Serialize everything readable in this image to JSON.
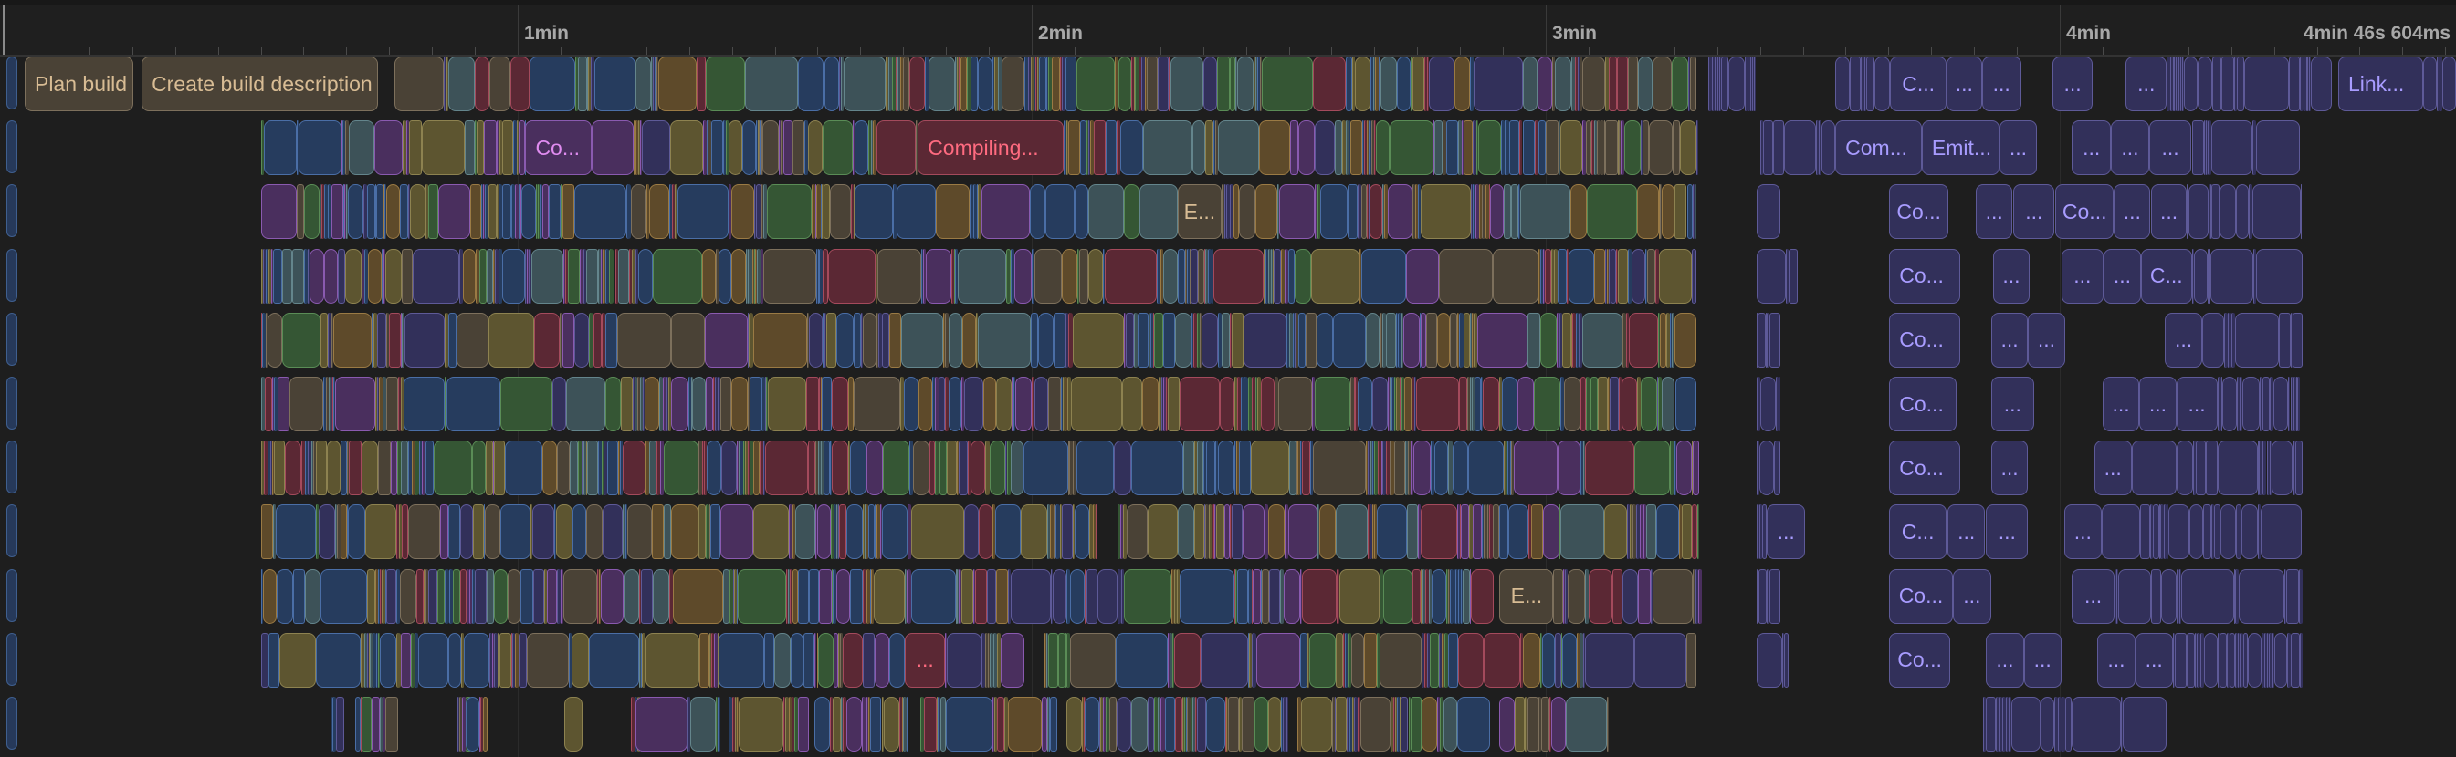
{
  "timeline": {
    "px_per_second_note": "scale handled in script",
    "axis": {
      "major_ticks": [
        {
          "seconds": 60,
          "label": "1min"
        },
        {
          "seconds": 120,
          "label": "2min"
        },
        {
          "seconds": 180,
          "label": "3min"
        },
        {
          "seconds": 240,
          "label": "4min"
        }
      ],
      "minor_tick_interval_seconds": 5,
      "end_label": "4min 46s 604ms",
      "total_duration_seconds": 286.604
    },
    "palette": {
      "olive": {
        "fill": "#5d5530",
        "border": "#8d8250",
        "text": "#d8c88a"
      },
      "blue": {
        "fill": "#263c5e",
        "border": "#4a6ea6",
        "text": "#9cc0ff"
      },
      "red": {
        "fill": "#5b2834",
        "border": "#a44a5c",
        "text": "#ff6b80"
      },
      "purple": {
        "fill": "#4a2f5e",
        "border": "#8a5ab0",
        "text": "#e08cf0"
      },
      "teal": {
        "fill": "#3d5258",
        "border": "#64858c",
        "text": "#a8d4dc"
      },
      "brown": {
        "fill": "#4a4236",
        "border": "#7d705c",
        "text": "#d8bc94"
      },
      "indigo": {
        "fill": "#32305a",
        "border": "#5e5a98",
        "text": "#a89cff"
      },
      "green": {
        "fill": "#355634",
        "border": "#5a8c56",
        "text": "#9ad896"
      },
      "orange": {
        "fill": "#5e4a2a",
        "border": "#9a7a44",
        "text": "#e6b878"
      }
    },
    "mixes": {
      "early": [
        "olive",
        "blue",
        "red",
        "purple",
        "teal",
        "brown",
        "indigo",
        "green",
        "orange",
        "blue",
        "blue",
        "olive"
      ],
      "mid": [
        "blue",
        "blue",
        "purple",
        "teal",
        "olive",
        "green",
        "red",
        "brown",
        "indigo",
        "orange"
      ],
      "late": [
        "brown",
        "brown",
        "red",
        "olive",
        "teal",
        "green",
        "purple",
        "indigo",
        "brown"
      ],
      "link": [
        "indigo"
      ]
    },
    "lanes": [
      {
        "name": "lane-1",
        "labeled": [
          {
            "start": 2.45,
            "end": 15.1,
            "color": "brown",
            "label": "Plan build"
          },
          {
            "start": 16.1,
            "end": 43.7,
            "color": "brown",
            "label": "Create build description"
          },
          {
            "start": 220.2,
            "end": 226.8,
            "color": "indigo",
            "label": "C..."
          },
          {
            "start": 226.8,
            "end": 230.9,
            "color": "indigo",
            "label": "..."
          },
          {
            "start": 230.9,
            "end": 235.5,
            "color": "indigo",
            "label": "..."
          },
          {
            "start": 239.2,
            "end": 243.8,
            "color": "indigo",
            "label": "..."
          },
          {
            "start": 247.7,
            "end": 252.5,
            "color": "indigo",
            "label": "..."
          },
          {
            "start": 272.5,
            "end": 282.4,
            "color": "indigo",
            "label": "Link..."
          }
        ],
        "streams": [
          {
            "start": 45.6,
            "end": 119.2,
            "mix": "early",
            "seed": 11
          },
          {
            "start": 119.2,
            "end": 179.0,
            "mix": "mid",
            "seed": 12
          },
          {
            "start": 179.0,
            "end": 197.6,
            "mix": "late",
            "seed": 13
          },
          {
            "start": 199.0,
            "end": 204.5,
            "mix": "link",
            "seed": 14
          },
          {
            "start": 213.8,
            "end": 220.2,
            "mix": "link",
            "seed": 15
          },
          {
            "start": 252.5,
            "end": 271.8,
            "mix": "link",
            "seed": 16
          },
          {
            "start": 282.4,
            "end": 286.6,
            "mix": "link",
            "seed": 17
          }
        ]
      },
      {
        "name": "lane-2",
        "labeled": [
          {
            "start": 60.9,
            "end": 68.6,
            "color": "purple",
            "label": "Co..."
          },
          {
            "start": 106.7,
            "end": 123.7,
            "color": "red",
            "label": "Compiling..."
          },
          {
            "start": 213.8,
            "end": 223.9,
            "color": "indigo",
            "label": "Com..."
          },
          {
            "start": 223.9,
            "end": 233.0,
            "color": "indigo",
            "label": "Emit..."
          },
          {
            "start": 233.0,
            "end": 237.3,
            "color": "indigo",
            "label": "..."
          },
          {
            "start": 241.4,
            "end": 246.0,
            "color": "indigo",
            "label": "..."
          },
          {
            "start": 246.0,
            "end": 250.4,
            "color": "indigo",
            "label": "..."
          },
          {
            "start": 250.4,
            "end": 255.4,
            "color": "indigo",
            "label": "..."
          }
        ],
        "streams": [
          {
            "start": 30.0,
            "end": 60.9,
            "mix": "early",
            "seed": 21
          },
          {
            "start": 68.6,
            "end": 106.7,
            "mix": "early",
            "seed": 22
          },
          {
            "start": 123.7,
            "end": 180.0,
            "mix": "mid",
            "seed": 23
          },
          {
            "start": 180.0,
            "end": 197.8,
            "mix": "late",
            "seed": 24
          },
          {
            "start": 205.0,
            "end": 213.8,
            "mix": "link",
            "seed": 25
          },
          {
            "start": 255.4,
            "end": 268.0,
            "mix": "link",
            "seed": 26
          }
        ]
      },
      {
        "name": "lane-3",
        "labeled": [
          {
            "start": 137.0,
            "end": 142.2,
            "color": "brown",
            "label": "E..."
          },
          {
            "start": 220.1,
            "end": 227.0,
            "color": "indigo",
            "label": "Co..."
          },
          {
            "start": 230.2,
            "end": 234.5,
            "color": "indigo",
            "label": "..."
          },
          {
            "start": 234.6,
            "end": 239.4,
            "color": "indigo",
            "label": "..."
          },
          {
            "start": 239.5,
            "end": 246.3,
            "color": "indigo",
            "label": "Co..."
          },
          {
            "start": 246.3,
            "end": 250.6,
            "color": "indigo",
            "label": "..."
          },
          {
            "start": 250.7,
            "end": 254.8,
            "color": "indigo",
            "label": "..."
          }
        ],
        "streams": [
          {
            "start": 30.0,
            "end": 137.0,
            "mix": "early",
            "seed": 31
          },
          {
            "start": 142.2,
            "end": 197.6,
            "mix": "mid",
            "seed": 32
          },
          {
            "start": 204.6,
            "end": 207.4,
            "mix": "link",
            "seed": 33
          },
          {
            "start": 254.8,
            "end": 268.2,
            "mix": "link",
            "seed": 34
          }
        ]
      },
      {
        "name": "lane-4",
        "labeled": [
          {
            "start": 220.1,
            "end": 228.4,
            "color": "indigo",
            "label": "Co..."
          },
          {
            "start": 232.2,
            "end": 236.5,
            "color": "indigo",
            "label": "..."
          },
          {
            "start": 240.2,
            "end": 245.1,
            "color": "indigo",
            "label": "..."
          },
          {
            "start": 245.1,
            "end": 249.5,
            "color": "indigo",
            "label": "..."
          },
          {
            "start": 249.5,
            "end": 255.4,
            "color": "indigo",
            "label": "C..."
          }
        ],
        "streams": [
          {
            "start": 30.0,
            "end": 197.6,
            "mix": "mid",
            "seed": 41
          },
          {
            "start": 204.6,
            "end": 209.4,
            "mix": "link",
            "seed": 42
          },
          {
            "start": 255.4,
            "end": 268.3,
            "mix": "link",
            "seed": 43
          }
        ]
      },
      {
        "name": "lane-5",
        "labeled": [
          {
            "start": 220.1,
            "end": 228.4,
            "color": "indigo",
            "label": "Co..."
          },
          {
            "start": 232.0,
            "end": 236.3,
            "color": "indigo",
            "label": "..."
          },
          {
            "start": 236.3,
            "end": 240.6,
            "color": "indigo",
            "label": "..."
          },
          {
            "start": 252.3,
            "end": 256.6,
            "color": "indigo",
            "label": "..."
          }
        ],
        "streams": [
          {
            "start": 30.0,
            "end": 197.6,
            "mix": "mid",
            "seed": 51
          },
          {
            "start": 204.6,
            "end": 207.4,
            "mix": "link",
            "seed": 52
          },
          {
            "start": 256.6,
            "end": 268.3,
            "mix": "link",
            "seed": 53
          }
        ]
      },
      {
        "name": "lane-6",
        "labeled": [
          {
            "start": 220.1,
            "end": 228.0,
            "color": "indigo",
            "label": "Co..."
          },
          {
            "start": 232.0,
            "end": 237.0,
            "color": "indigo",
            "label": "..."
          },
          {
            "start": 245.0,
            "end": 249.3,
            "color": "indigo",
            "label": "..."
          },
          {
            "start": 249.3,
            "end": 253.6,
            "color": "indigo",
            "label": "..."
          },
          {
            "start": 253.6,
            "end": 258.4,
            "color": "indigo",
            "label": "..."
          }
        ],
        "streams": [
          {
            "start": 30.0,
            "end": 197.6,
            "mix": "mid",
            "seed": 61
          },
          {
            "start": 204.6,
            "end": 207.4,
            "mix": "link",
            "seed": 62
          },
          {
            "start": 258.4,
            "end": 268.0,
            "mix": "link",
            "seed": 63
          }
        ]
      },
      {
        "name": "lane-7",
        "labeled": [
          {
            "start": 220.1,
            "end": 228.4,
            "color": "indigo",
            "label": "Co..."
          },
          {
            "start": 232.0,
            "end": 236.3,
            "color": "indigo",
            "label": "..."
          },
          {
            "start": 244.0,
            "end": 248.4,
            "color": "indigo",
            "label": "..."
          }
        ],
        "streams": [
          {
            "start": 30.0,
            "end": 197.9,
            "mix": "mid",
            "seed": 71
          },
          {
            "start": 204.6,
            "end": 207.4,
            "mix": "link",
            "seed": 72
          },
          {
            "start": 248.4,
            "end": 268.3,
            "mix": "link",
            "seed": 73
          }
        ]
      },
      {
        "name": "lane-8",
        "labeled": [
          {
            "start": 205.8,
            "end": 210.3,
            "color": "indigo",
            "label": "..."
          },
          {
            "start": 220.1,
            "end": 226.8,
            "color": "indigo",
            "label": "C..."
          },
          {
            "start": 226.9,
            "end": 231.3,
            "color": "indigo",
            "label": "..."
          },
          {
            "start": 231.4,
            "end": 236.3,
            "color": "indigo",
            "label": "..."
          },
          {
            "start": 240.5,
            "end": 244.9,
            "color": "indigo",
            "label": "..."
          }
        ],
        "streams": [
          {
            "start": 30.0,
            "end": 127.6,
            "mix": "early",
            "seed": 81
          },
          {
            "start": 130.0,
            "end": 197.8,
            "mix": "mid",
            "seed": 82
          },
          {
            "start": 204.6,
            "end": 205.8,
            "mix": "link",
            "seed": 83
          },
          {
            "start": 244.9,
            "end": 268.3,
            "mix": "link",
            "seed": 84
          }
        ]
      },
      {
        "name": "lane-9",
        "labeled": [
          {
            "start": 174.6,
            "end": 180.9,
            "color": "brown",
            "label": "E..."
          },
          {
            "start": 220.1,
            "end": 227.5,
            "color": "indigo",
            "label": "Co..."
          },
          {
            "start": 227.5,
            "end": 232.0,
            "color": "indigo",
            "label": "..."
          },
          {
            "start": 241.4,
            "end": 246.4,
            "color": "indigo",
            "label": "..."
          }
        ],
        "streams": [
          {
            "start": 30.0,
            "end": 173.9,
            "mix": "mid",
            "seed": 91
          },
          {
            "start": 180.9,
            "end": 198.2,
            "mix": "late",
            "seed": 92
          },
          {
            "start": 204.6,
            "end": 207.4,
            "mix": "link",
            "seed": 93
          },
          {
            "start": 246.4,
            "end": 268.3,
            "mix": "link",
            "seed": 94
          }
        ]
      },
      {
        "name": "lane-10",
        "labeled": [
          {
            "start": 105.2,
            "end": 109.9,
            "color": "red",
            "label": "..."
          },
          {
            "start": 220.1,
            "end": 227.2,
            "color": "indigo",
            "label": "Co..."
          },
          {
            "start": 231.4,
            "end": 235.8,
            "color": "indigo",
            "label": "..."
          },
          {
            "start": 235.8,
            "end": 240.2,
            "color": "indigo",
            "label": "..."
          },
          {
            "start": 244.4,
            "end": 248.8,
            "color": "indigo",
            "label": "..."
          },
          {
            "start": 248.8,
            "end": 253.2,
            "color": "indigo",
            "label": "..."
          }
        ],
        "streams": [
          {
            "start": 30.0,
            "end": 105.2,
            "mix": "early",
            "seed": 101
          },
          {
            "start": 109.9,
            "end": 119.2,
            "mix": "mid",
            "seed": 102
          },
          {
            "start": 121.5,
            "end": 197.6,
            "mix": "mid",
            "seed": 103
          },
          {
            "start": 204.6,
            "end": 208.4,
            "mix": "link",
            "seed": 104
          },
          {
            "start": 253.2,
            "end": 268.3,
            "mix": "link",
            "seed": 105
          }
        ]
      },
      {
        "name": "lane-11",
        "labeled": [],
        "streams": [
          {
            "start": 38.2,
            "end": 39.8,
            "mix": "early",
            "seed": 111
          },
          {
            "start": 41.0,
            "end": 46.0,
            "mix": "early",
            "seed": 112
          },
          {
            "start": 53.0,
            "end": 55.0,
            "mix": "early",
            "seed": 113
          },
          {
            "start": 53.5,
            "end": 56.5,
            "mix": "early",
            "seed": 114
          },
          {
            "start": 65.4,
            "end": 67.6,
            "mix": "early",
            "seed": 115
          },
          {
            "start": 73.2,
            "end": 74.6,
            "mix": "mid",
            "seed": 116
          },
          {
            "start": 73.7,
            "end": 83.7,
            "mix": "mid",
            "seed": 117
          },
          {
            "start": 84.6,
            "end": 94.0,
            "mix": "mid",
            "seed": 118
          },
          {
            "start": 94.6,
            "end": 105.6,
            "mix": "mid",
            "seed": 119
          },
          {
            "start": 107.0,
            "end": 123.0,
            "mix": "mid",
            "seed": 120
          },
          {
            "start": 124.0,
            "end": 150.0,
            "mix": "mid",
            "seed": 121
          },
          {
            "start": 151.0,
            "end": 173.5,
            "mix": "mid",
            "seed": 122
          },
          {
            "start": 174.6,
            "end": 187.3,
            "mix": "late",
            "seed": 123
          },
          {
            "start": 231.0,
            "end": 252.5,
            "mix": "link",
            "seed": 124
          }
        ]
      }
    ]
  }
}
